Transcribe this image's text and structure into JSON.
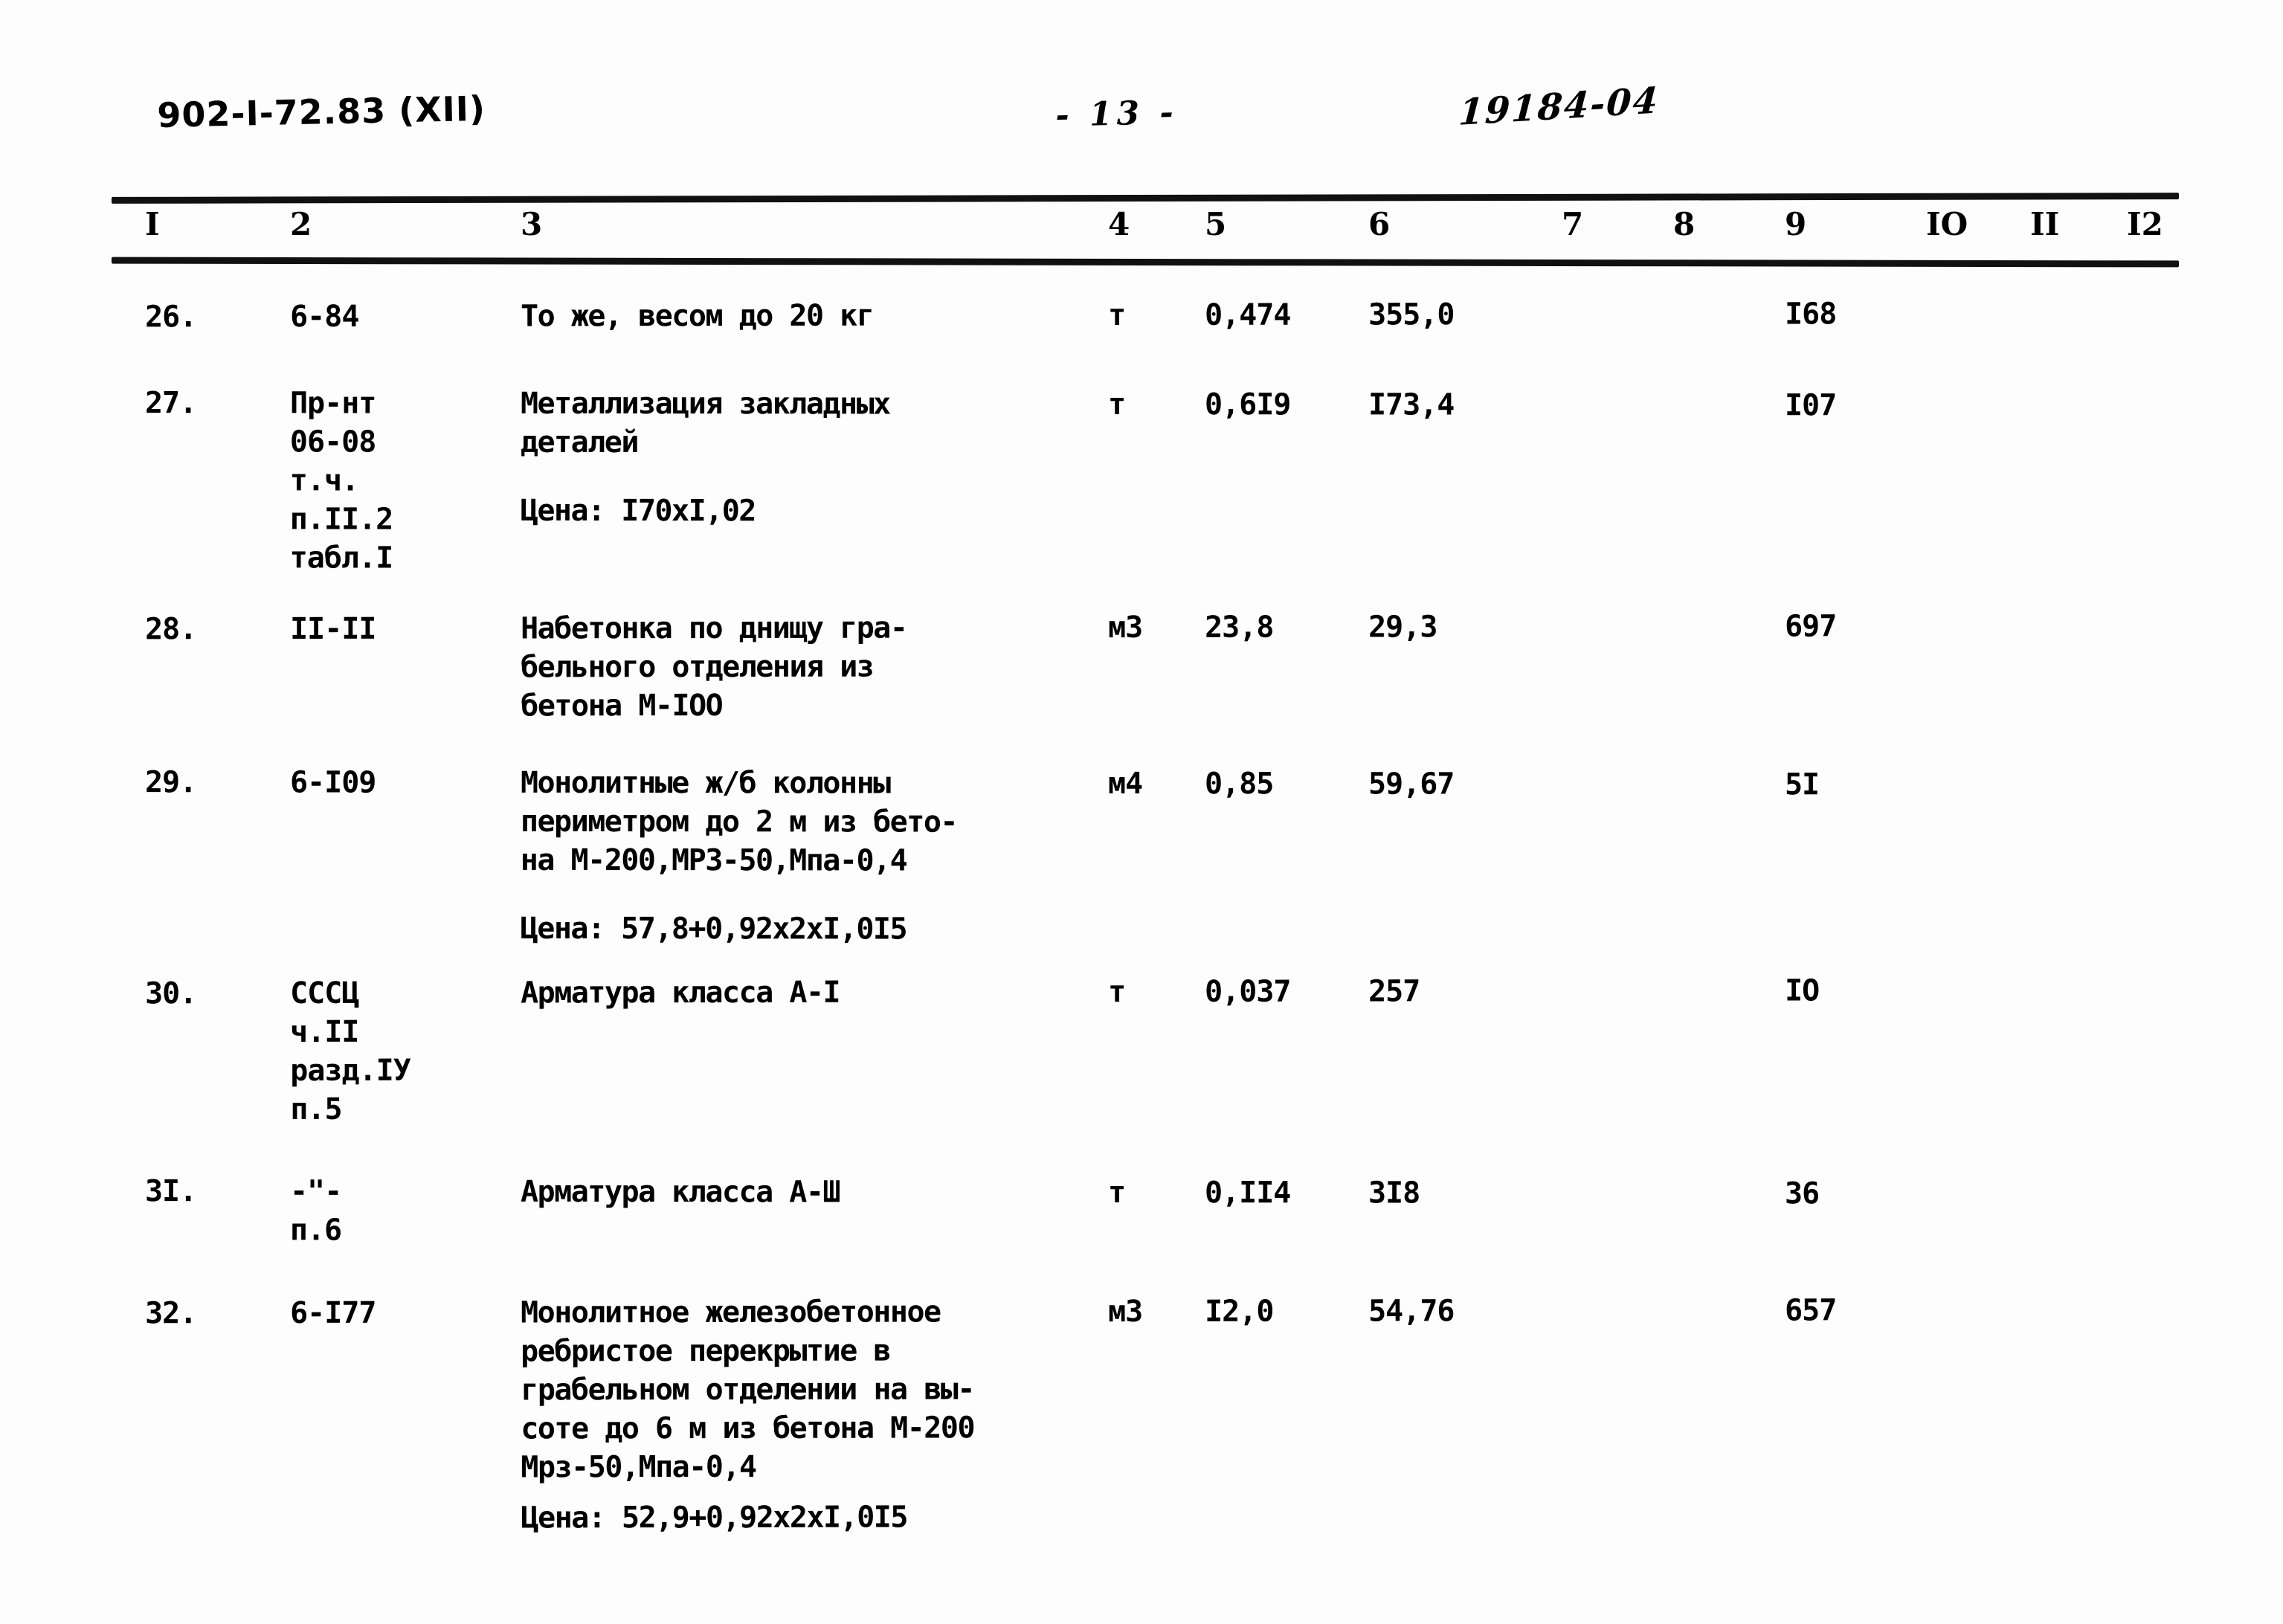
{
  "header": {
    "doc_code": "902-I-72.83  (XII)",
    "page_number": "-  13  -",
    "archive_code": "19184-04"
  },
  "table": {
    "column_headers": [
      "I",
      "2",
      "3",
      "4",
      "5",
      "6",
      "7",
      "8",
      "9",
      "IO",
      "II",
      "I2"
    ],
    "rows": [
      {
        "num": "26.",
        "code": "6-84",
        "description": "То же, весом до 20 кг",
        "unit": "т",
        "qty": "0,474",
        "price": "355,0",
        "col7": "",
        "col8": "",
        "total": "I68",
        "col10": "",
        "col11": "",
        "col12": "",
        "price_note": ""
      },
      {
        "num": "27.",
        "code": "Пр-нт\n06-08\nт.ч.\nп.II.2\nтабл.I",
        "description": "Металлизация закладных\nдеталей",
        "unit": "т",
        "qty": "0,6I9",
        "price": "I73,4",
        "col7": "",
        "col8": "",
        "total": "I07",
        "col10": "",
        "col11": "",
        "col12": "",
        "price_note": "Цена: I70xI,02"
      },
      {
        "num": "28.",
        "code": "II-II",
        "description": "Набетонка по днищу гра-\nбельного отделения из\nбетона М-IOO",
        "unit": "м3",
        "qty": "23,8",
        "price": "29,3",
        "col7": "",
        "col8": "",
        "total": "697",
        "col10": "",
        "col11": "",
        "col12": "",
        "price_note": ""
      },
      {
        "num": "29.",
        "code": "6-I09",
        "description": "Монолитные ж/б колонны\nпериметром до 2 м из бето-\nна М-200,МРЗ-50,Мпа-0,4",
        "unit": "м4",
        "qty": "0,85",
        "price": "59,67",
        "col7": "",
        "col8": "",
        "total": "5I",
        "col10": "",
        "col11": "",
        "col12": "",
        "price_note": "Цена: 57,8+0,92x2xI,0I5"
      },
      {
        "num": "30.",
        "code": "СССЦ\nч.II\nразд.IУ\nп.5",
        "description": "Арматура класса А-I",
        "unit": "т",
        "qty": "0,037",
        "price": "257",
        "col7": "",
        "col8": "",
        "total": "IO",
        "col10": "",
        "col11": "",
        "col12": "",
        "price_note": ""
      },
      {
        "num": "3I.",
        "code": "-\"-\nп.6",
        "description": "Арматура класса А-Ш",
        "unit": "т",
        "qty": "0,II4",
        "price": "3I8",
        "col7": "",
        "col8": "",
        "total": "36",
        "col10": "",
        "col11": "",
        "col12": "",
        "price_note": ""
      },
      {
        "num": "32.",
        "code": "6-I77",
        "description": "Монолитное железобетонное\nребристое перекрытие в\nграбельном отделении на вы-\nсоте до 6 м из бетона М-200\nМрз-50,Мпа-0,4",
        "unit": "м3",
        "qty": "I2,0",
        "price": "54,76",
        "col7": "",
        "col8": "",
        "total": "657",
        "col10": "",
        "col11": "",
        "col12": "",
        "price_note": "Цена: 52,9+0,92x2xI,0I5"
      }
    ]
  },
  "layout": {
    "column_x": [
      195,
      390,
      700,
      1490,
      1620,
      1840,
      2100,
      2250,
      2400,
      2590,
      2730,
      2860
    ],
    "row_y": [
      398,
      518,
      818,
      1028,
      1308,
      1578,
      1738
    ],
    "ink_color": "#111111",
    "paper_color": "#fdfdfd"
  }
}
